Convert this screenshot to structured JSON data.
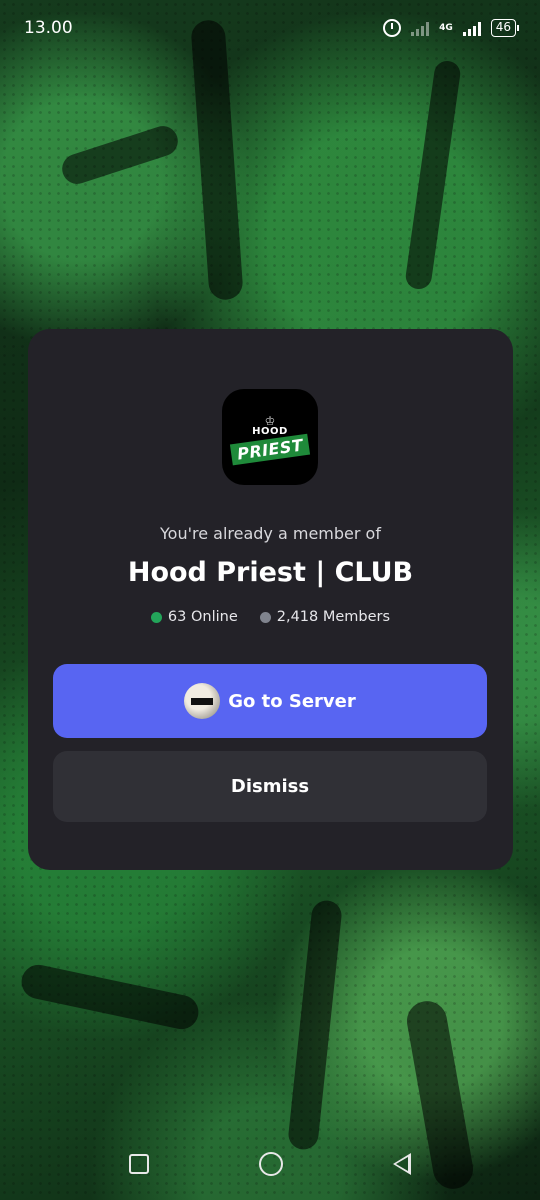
{
  "status_bar": {
    "time": "13.00",
    "network": "4G",
    "battery": "46"
  },
  "modal": {
    "server_icon_text": {
      "crown": "♔",
      "line1": "HOOD",
      "line2": "PRIEST"
    },
    "subtitle": "You're already a member of",
    "server_name": "Hood Priest | CLUB",
    "online": {
      "label": "63 Online",
      "color": "#23a55a"
    },
    "members": {
      "label": "2,418 Members",
      "color": "#80848e"
    },
    "primary_button": {
      "label": "Go to Server",
      "color": "#5865f2"
    },
    "secondary_button": {
      "label": "Dismiss"
    }
  },
  "colors": {
    "card": "#232228",
    "secondary_button": "#303036"
  }
}
